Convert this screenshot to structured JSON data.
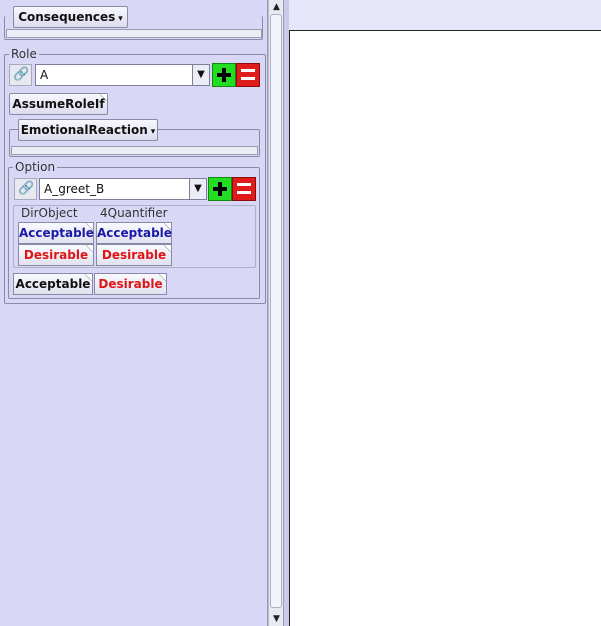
{
  "left_panel": {
    "consequences_label": "Consequences",
    "role": {
      "legend": "Role",
      "selected": "A",
      "assume_button": "AssumeRoleIf",
      "emotional_label": "EmotionalReaction"
    },
    "option": {
      "legend": "Option",
      "selected": "A_greet_B",
      "columns": [
        "DirObject",
        "4Quantifier"
      ],
      "rows": [
        [
          "Acceptable",
          "Acceptable"
        ],
        [
          "Desirable",
          "Desirable"
        ]
      ],
      "footer": [
        "Acceptable",
        "Desirable"
      ]
    }
  },
  "icons": {
    "link": "link-icon",
    "dropdown": "chevron-down-icon",
    "plus": "plus-icon",
    "minus": "minus-icon"
  },
  "colors": {
    "acceptable_text": "#1a1aa8",
    "desirable_text": "#e01515",
    "plus_bg": "#22dd22",
    "minus_bg": "#e01b1b"
  }
}
